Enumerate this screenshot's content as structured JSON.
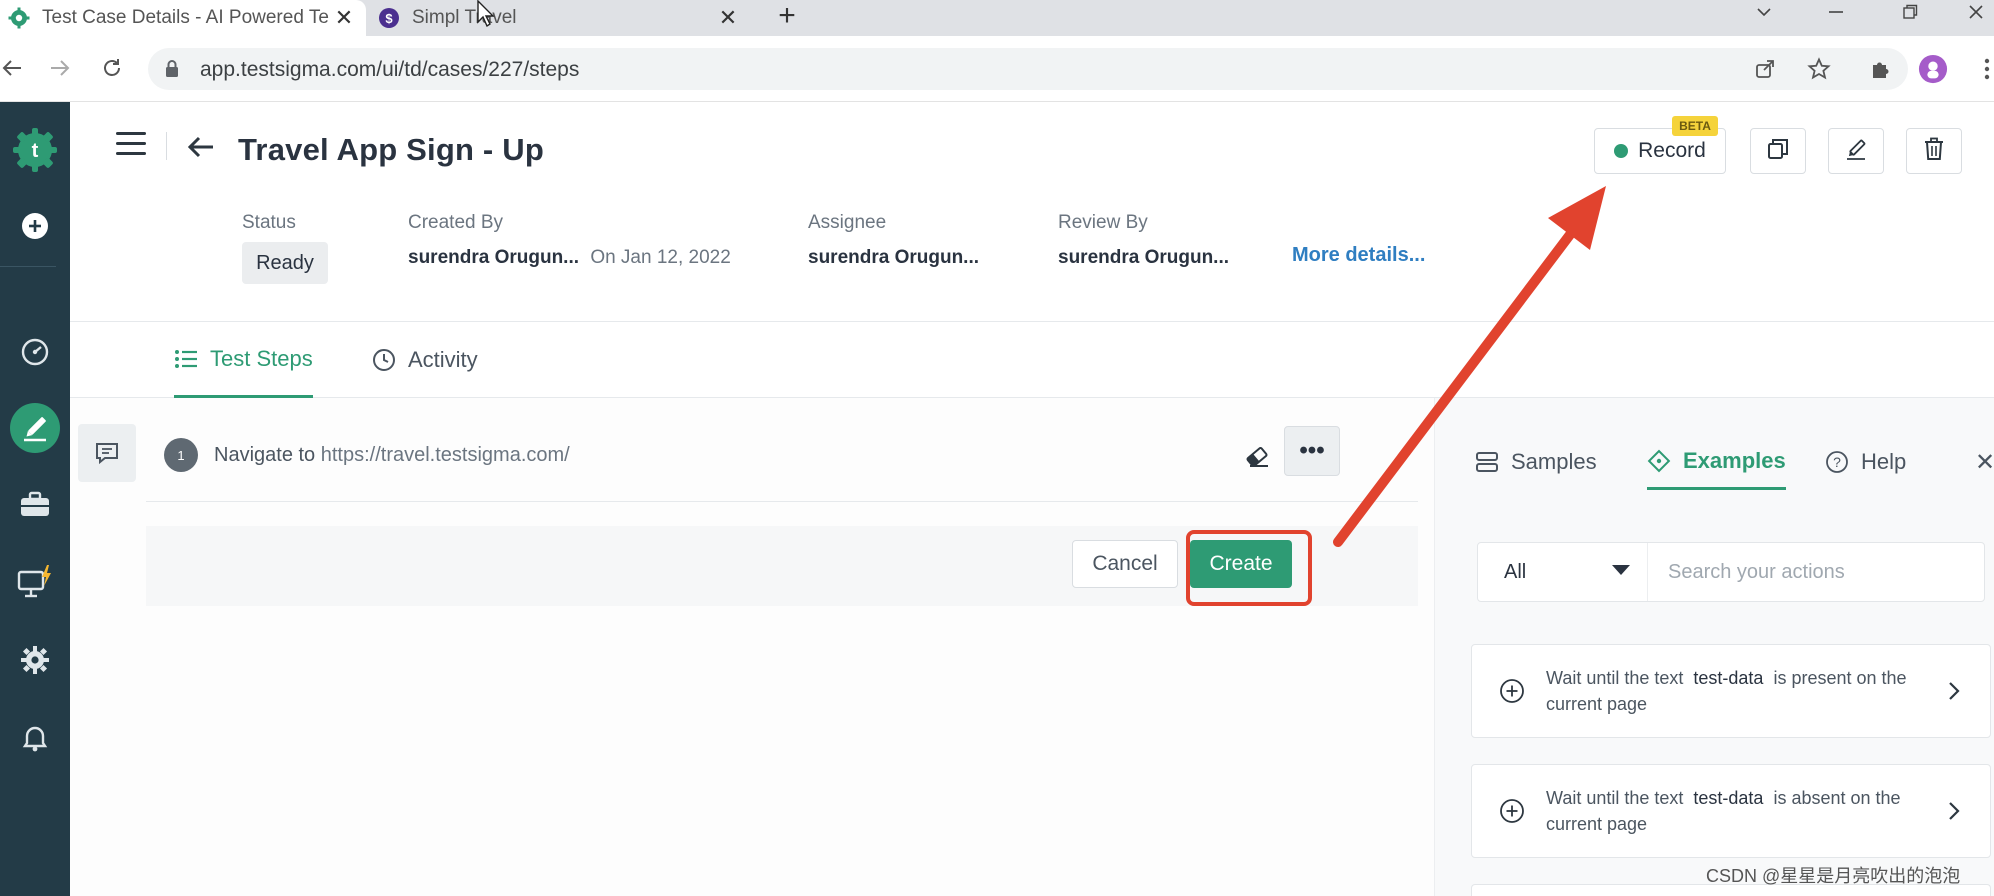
{
  "browser": {
    "tabs": [
      {
        "title": "Test Case Details - AI Powered Te",
        "active": true
      },
      {
        "title": "Simpl Travel",
        "active": false
      }
    ],
    "url": "app.testsigma.com/ui/td/cases/227/steps"
  },
  "sidebar": {
    "items": [
      "logo",
      "add",
      "dashboard",
      "test-development",
      "test-suites",
      "test-devices",
      "settings",
      "notifications"
    ]
  },
  "header": {
    "title": "Travel App Sign - Up",
    "record_label": "Record",
    "beta_label": "BETA",
    "meta": {
      "status_label": "Status",
      "status_value": "Ready",
      "created_by_label": "Created By",
      "created_by_value": "surendra Orugun...",
      "created_on": "On Jan 12, 2022",
      "assignee_label": "Assignee",
      "assignee_value": "surendra Orugun...",
      "review_by_label": "Review By",
      "review_by_value": "surendra Orugun...",
      "more_details": "More details..."
    }
  },
  "tabs": [
    {
      "label": "Test Steps",
      "active": true
    },
    {
      "label": "Activity",
      "active": false
    }
  ],
  "steps": [
    {
      "number": "1",
      "action": "Navigate to",
      "value": "https://travel.testsigma.com/"
    }
  ],
  "create_panel": {
    "cancel_label": "Cancel",
    "create_label": "Create"
  },
  "right_panel": {
    "tabs": [
      {
        "label": "Samples",
        "active": false
      },
      {
        "label": "Examples",
        "active": true
      },
      {
        "label": "Help",
        "active": false
      }
    ],
    "close_label": "✕",
    "filter": {
      "selected": "All",
      "search_placeholder": "Search your actions"
    },
    "examples": [
      {
        "prefix": "Wait until the text",
        "token": "test-data",
        "suffix": "is present on the current page"
      },
      {
        "prefix": "Wait until the text",
        "token": "test-data",
        "suffix": "is absent on the current page"
      }
    ]
  },
  "watermark": "CSDN @星星是月亮吹出的泡泡",
  "colors": {
    "brand_green": "#2e9b74",
    "sidebar_bg": "#233b47",
    "annotation_red": "#e1432e",
    "link_blue": "#2f7ec1"
  }
}
